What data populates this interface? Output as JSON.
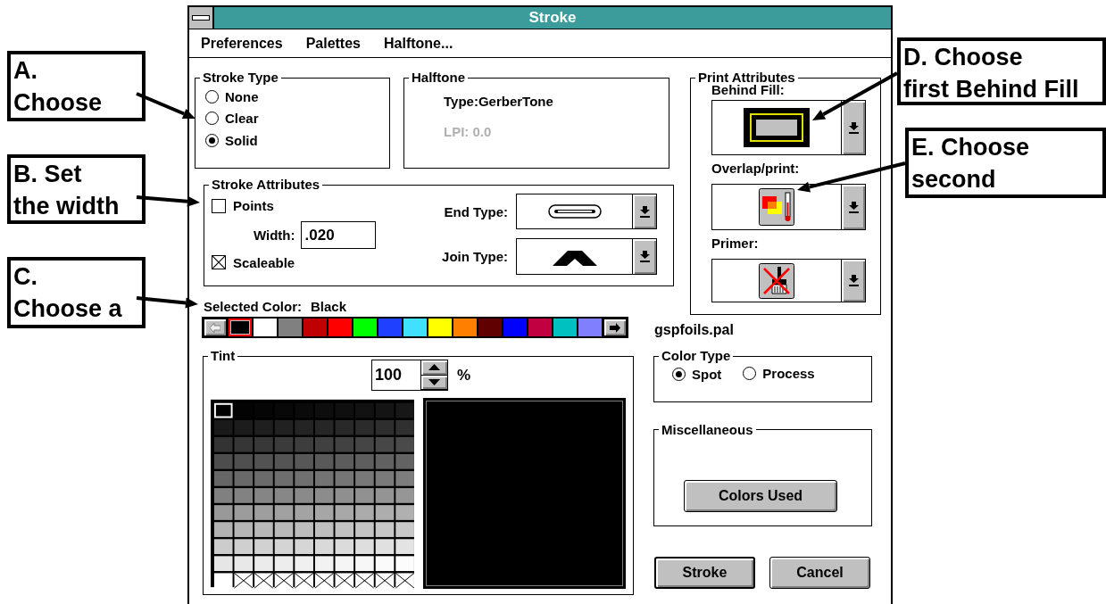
{
  "window": {
    "title": "Stroke"
  },
  "menu": [
    {
      "label": "Preferences"
    },
    {
      "label": "Palettes"
    },
    {
      "label": "Halftone..."
    }
  ],
  "stroke_type": {
    "title": "Stroke Type",
    "options": [
      {
        "label": "None",
        "selected": false
      },
      {
        "label": "Clear",
        "selected": false
      },
      {
        "label": "Solid",
        "selected": true
      }
    ]
  },
  "halftone": {
    "title": "Halftone",
    "type": "Type:GerberTone",
    "lpi": {
      "text": "LPI: 0.0",
      "disabled": true
    }
  },
  "stroke_attributes": {
    "title": "Stroke Attributes",
    "points": {
      "label": "Points",
      "checked": false
    },
    "width": {
      "label": "Width:",
      "value": ".020"
    },
    "scaleable": {
      "label": "Scaleable",
      "checked": true
    },
    "end_type": {
      "label": "End Type:",
      "kind": "end-cap"
    },
    "join_type": {
      "label": "Join Type:",
      "kind": "join"
    }
  },
  "selected_color": {
    "label": "Selected Color:",
    "value": "Black"
  },
  "palette": {
    "swatches": [
      {
        "color": "#000000",
        "selected": true
      },
      {
        "color": "#ffffff",
        "selected": false
      },
      {
        "color": "#808080",
        "selected": false
      },
      {
        "color": "#c00000",
        "selected": false
      },
      {
        "color": "#ff0000",
        "selected": false
      },
      {
        "color": "#00ff00",
        "selected": false
      },
      {
        "color": "#2040ff",
        "selected": false
      },
      {
        "color": "#40e0ff",
        "selected": false
      },
      {
        "color": "#ffff00",
        "selected": false
      },
      {
        "color": "#ff8000",
        "selected": false
      },
      {
        "color": "#600000",
        "selected": false
      },
      {
        "color": "#0000ff",
        "selected": false
      },
      {
        "color": "#c00040",
        "selected": false
      },
      {
        "color": "#00c0c0",
        "selected": false
      },
      {
        "color": "#8080ff",
        "selected": false
      }
    ],
    "file": "gspfoils.pal"
  },
  "print_attributes": {
    "title": "Print Attributes",
    "fields": [
      {
        "label": "Behind Fill:",
        "kind": "frame"
      },
      {
        "label": "Overlap/print:",
        "kind": "thermometer"
      },
      {
        "label": "Primer:",
        "kind": "brush"
      }
    ]
  },
  "tint": {
    "title": "Tint",
    "value": "100",
    "unit": "%"
  },
  "color_type": {
    "title": "Color Type",
    "options": [
      {
        "label": "Spot",
        "selected": true
      },
      {
        "label": "Process",
        "selected": false
      }
    ]
  },
  "miscellaneous": {
    "title": "Miscellaneous",
    "button": "Colors Used"
  },
  "buttons": [
    {
      "label": "Stroke",
      "default": true
    },
    {
      "label": "Cancel",
      "default": false
    }
  ],
  "annotations": [
    {
      "lines": [
        "A.",
        "Choose"
      ]
    },
    {
      "lines": [
        "B.  Set",
        "the width"
      ]
    },
    {
      "lines": [
        "C.",
        "Choose a"
      ]
    },
    {
      "lines": [
        "D.  Choose",
        "first Behind Fill"
      ]
    },
    {
      "lines": [
        "E.  Choose",
        "second"
      ]
    }
  ]
}
